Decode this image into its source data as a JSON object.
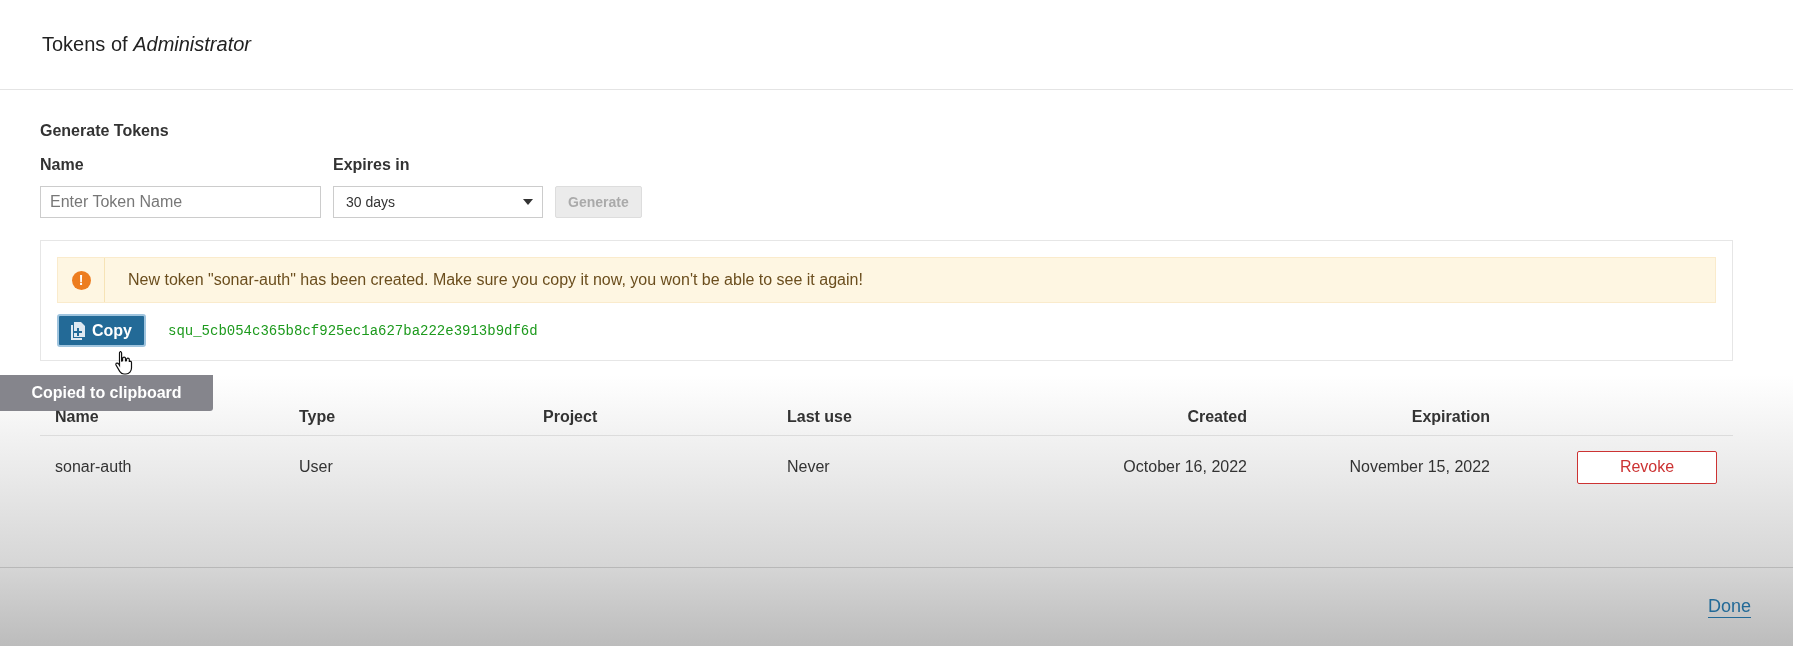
{
  "dialog": {
    "title_prefix": "Tokens of ",
    "title_user": "Administrator"
  },
  "generate": {
    "heading": "Generate Tokens",
    "name_label": "Name",
    "name_placeholder": "Enter Token Name",
    "expires_label": "Expires in",
    "expires_value": "30 days",
    "generate_button": {
      "label": "Generate",
      "disabled": true
    }
  },
  "alert": {
    "message": "New token \"sonar-auth\" has been created. Make sure you copy it now, you won't be able to see it again!",
    "icon": "!",
    "copy_button": "Copy",
    "token": "squ_5cb054c365b8cf925ec1a627ba222e3913b9df6d"
  },
  "tooltip": {
    "text": "Copied to clipboard"
  },
  "table": {
    "columns": [
      "Name",
      "Type",
      "Project",
      "Last use",
      "Created",
      "Expiration"
    ],
    "rows": [
      {
        "cells": [
          "sonar-auth",
          "User",
          "",
          "Never",
          "October 16, 2022",
          "November 15, 2022"
        ],
        "action": "Revoke"
      }
    ]
  },
  "footer": {
    "done": "Done"
  }
}
